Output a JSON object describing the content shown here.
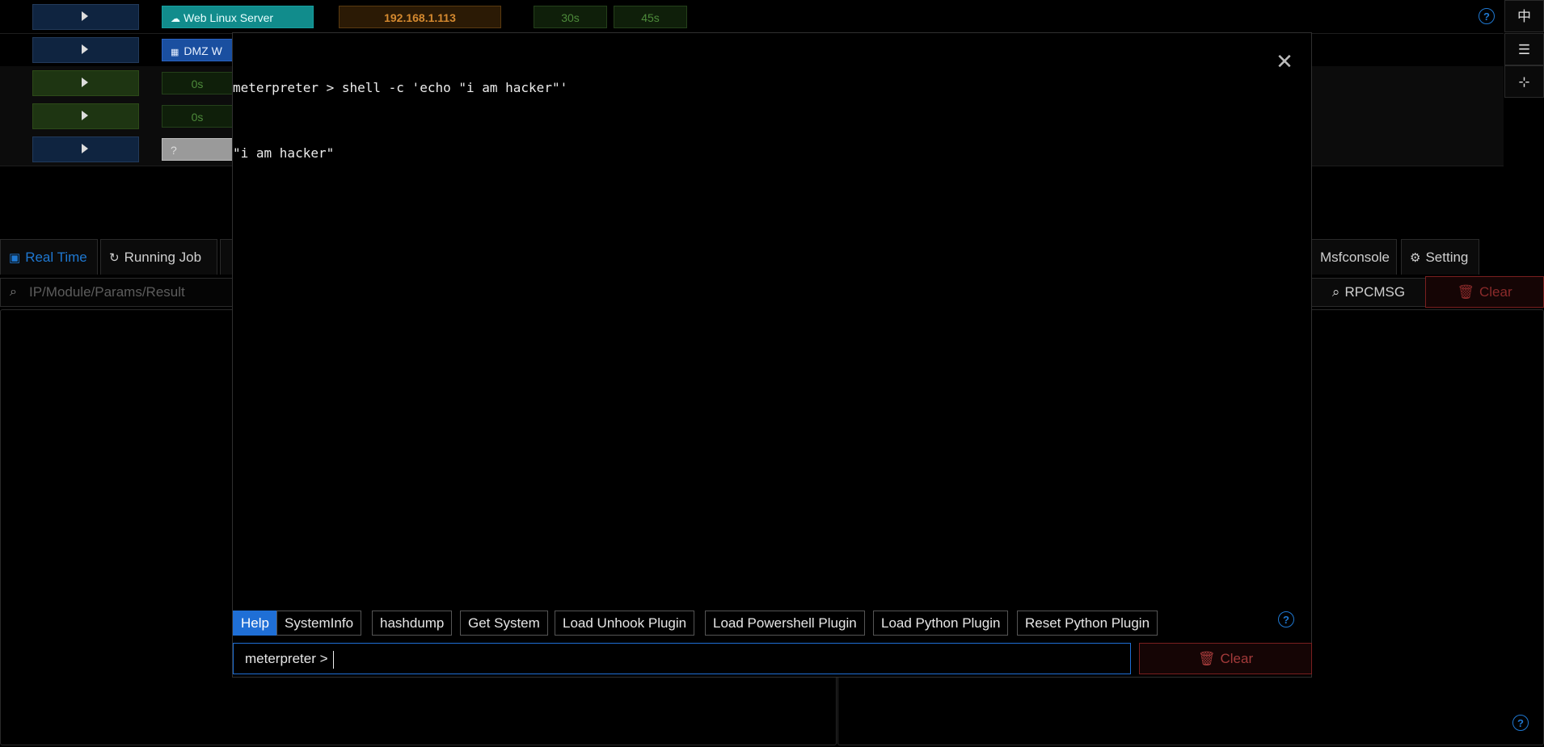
{
  "sessions": {
    "rows": [
      {
        "host_tag": "Web Linux Server",
        "ip": "192.168.1.113",
        "t1": "30s",
        "t2": "45s"
      },
      {
        "host_tag": "DMZ W"
      },
      {
        "t1": "0s"
      },
      {
        "t1": "0s"
      },
      {
        "host_tag": "?"
      }
    ]
  },
  "right_toolbar": {
    "lang": "中"
  },
  "tabs": {
    "real_time": "Real Time",
    "running_job": "Running Job",
    "msfconsole": "Msfconsole",
    "setting": "Setting"
  },
  "filter": {
    "placeholder": "IP/Module/Params/Result",
    "rpcmsg": "RPCMSG",
    "clear": "Clear"
  },
  "terminal": {
    "lines": [
      "meterpreter > shell -c 'echo \"i am hacker\"'",
      "\"i am hacker\""
    ],
    "quick_commands": [
      "Help",
      "SystemInfo",
      "hashdump",
      "Get System",
      "Load Unhook Plugin",
      "Load Powershell Plugin",
      "Load Python Plugin",
      "Reset Python Plugin"
    ],
    "prompt": "meterpreter >",
    "clear": "Clear"
  },
  "colors": {
    "accent": "#1f78d1",
    "danger": "#a33a3a",
    "ip_orange": "#d4892f",
    "timer_green": "#4d8a3a"
  },
  "icons": [
    "cloud-icon",
    "cluster-icon",
    "question-icon",
    "close-icon",
    "history-icon",
    "setting-icon",
    "search-icon",
    "delete-icon",
    "dashboard-icon"
  ]
}
